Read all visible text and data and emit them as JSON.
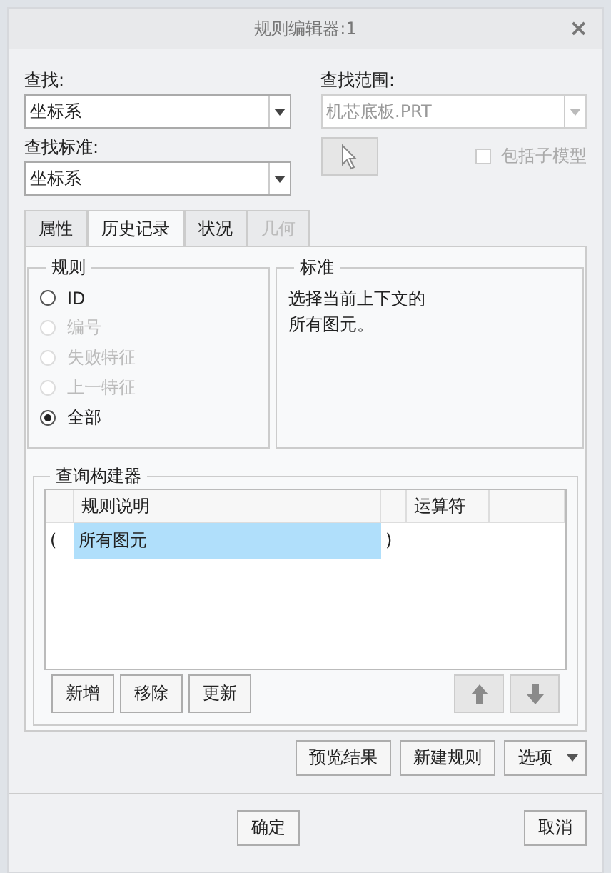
{
  "window": {
    "title": "规则编辑器:1",
    "close": "×"
  },
  "find": {
    "label": "查找:",
    "value": "坐标系"
  },
  "scope": {
    "label": "查找范围:",
    "value": "机芯底板.PRT",
    "disabled": true
  },
  "criteria": {
    "label": "查找标准:",
    "value": "坐标系"
  },
  "include_submodels": {
    "label": "包括子模型",
    "checked": false,
    "disabled": true
  },
  "tabs": [
    {
      "label": "属性",
      "selected": false,
      "disabled": false
    },
    {
      "label": "历史记录",
      "selected": true,
      "disabled": false
    },
    {
      "label": "状况",
      "selected": false,
      "disabled": false
    },
    {
      "label": "几何",
      "selected": false,
      "disabled": true
    }
  ],
  "rules": {
    "title": "规则",
    "options": [
      {
        "label": "ID",
        "selected": false,
        "disabled": false
      },
      {
        "label": "编号",
        "selected": false,
        "disabled": true
      },
      {
        "label": "失败特征",
        "selected": false,
        "disabled": true
      },
      {
        "label": "上一特征",
        "selected": false,
        "disabled": true
      },
      {
        "label": "全部",
        "selected": true,
        "disabled": false
      }
    ]
  },
  "standard": {
    "title": "标准",
    "text": "选择当前上下文的所有图元。"
  },
  "query_builder": {
    "title": "查询构建器",
    "columns": [
      "规则说明",
      "运算符"
    ],
    "rows": [
      {
        "open": "(",
        "rule": "所有图元",
        "close": ")",
        "selected": true
      }
    ],
    "buttons": [
      "新增",
      "移除",
      "更新"
    ]
  },
  "actions": [
    "预览结果",
    "新建规则"
  ],
  "options_button": "选项",
  "footer_buttons": [
    "确定",
    "取消"
  ]
}
